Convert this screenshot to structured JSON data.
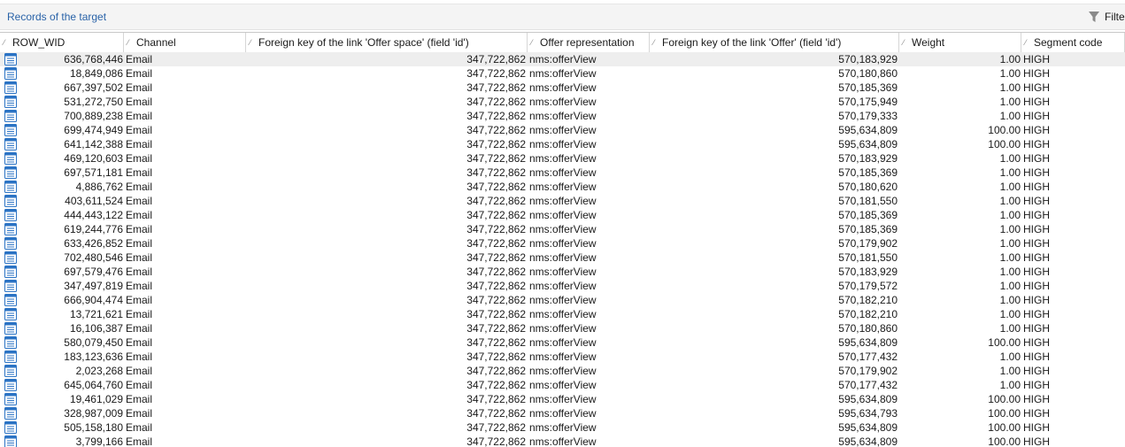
{
  "panel": {
    "title": "Records of the target"
  },
  "toolbar": {
    "filter_label": "Filte"
  },
  "table": {
    "columns": [
      "ROW_WID",
      "Channel",
      "Foreign key of the link 'Offer space' (field 'id')",
      "Offer representation",
      "Foreign key of the link 'Offer' (field 'id')",
      "Weight",
      "Segment code"
    ],
    "rows": [
      [
        "636,768,446",
        "Email",
        "347,722,862",
        "nms:offerView",
        "570,183,929",
        "1.00",
        "HIGH"
      ],
      [
        "18,849,086",
        "Email",
        "347,722,862",
        "nms:offerView",
        "570,180,860",
        "1.00",
        "HIGH"
      ],
      [
        "667,397,502",
        "Email",
        "347,722,862",
        "nms:offerView",
        "570,185,369",
        "1.00",
        "HIGH"
      ],
      [
        "531,272,750",
        "Email",
        "347,722,862",
        "nms:offerView",
        "570,175,949",
        "1.00",
        "HIGH"
      ],
      [
        "700,889,238",
        "Email",
        "347,722,862",
        "nms:offerView",
        "570,179,333",
        "1.00",
        "HIGH"
      ],
      [
        "699,474,949",
        "Email",
        "347,722,862",
        "nms:offerView",
        "595,634,809",
        "100.00",
        "HIGH"
      ],
      [
        "641,142,388",
        "Email",
        "347,722,862",
        "nms:offerView",
        "595,634,809",
        "100.00",
        "HIGH"
      ],
      [
        "469,120,603",
        "Email",
        "347,722,862",
        "nms:offerView",
        "570,183,929",
        "1.00",
        "HIGH"
      ],
      [
        "697,571,181",
        "Email",
        "347,722,862",
        "nms:offerView",
        "570,185,369",
        "1.00",
        "HIGH"
      ],
      [
        "4,886,762",
        "Email",
        "347,722,862",
        "nms:offerView",
        "570,180,620",
        "1.00",
        "HIGH"
      ],
      [
        "403,611,524",
        "Email",
        "347,722,862",
        "nms:offerView",
        "570,181,550",
        "1.00",
        "HIGH"
      ],
      [
        "444,443,122",
        "Email",
        "347,722,862",
        "nms:offerView",
        "570,185,369",
        "1.00",
        "HIGH"
      ],
      [
        "619,244,776",
        "Email",
        "347,722,862",
        "nms:offerView",
        "570,185,369",
        "1.00",
        "HIGH"
      ],
      [
        "633,426,852",
        "Email",
        "347,722,862",
        "nms:offerView",
        "570,179,902",
        "1.00",
        "HIGH"
      ],
      [
        "702,480,546",
        "Email",
        "347,722,862",
        "nms:offerView",
        "570,181,550",
        "1.00",
        "HIGH"
      ],
      [
        "697,579,476",
        "Email",
        "347,722,862",
        "nms:offerView",
        "570,183,929",
        "1.00",
        "HIGH"
      ],
      [
        "347,497,819",
        "Email",
        "347,722,862",
        "nms:offerView",
        "570,179,572",
        "1.00",
        "HIGH"
      ],
      [
        "666,904,474",
        "Email",
        "347,722,862",
        "nms:offerView",
        "570,182,210",
        "1.00",
        "HIGH"
      ],
      [
        "13,721,621",
        "Email",
        "347,722,862",
        "nms:offerView",
        "570,182,210",
        "1.00",
        "HIGH"
      ],
      [
        "16,106,387",
        "Email",
        "347,722,862",
        "nms:offerView",
        "570,180,860",
        "1.00",
        "HIGH"
      ],
      [
        "580,079,450",
        "Email",
        "347,722,862",
        "nms:offerView",
        "595,634,809",
        "100.00",
        "HIGH"
      ],
      [
        "183,123,636",
        "Email",
        "347,722,862",
        "nms:offerView",
        "570,177,432",
        "1.00",
        "HIGH"
      ],
      [
        "2,023,268",
        "Email",
        "347,722,862",
        "nms:offerView",
        "570,179,902",
        "1.00",
        "HIGH"
      ],
      [
        "645,064,760",
        "Email",
        "347,722,862",
        "nms:offerView",
        "570,177,432",
        "1.00",
        "HIGH"
      ],
      [
        "19,461,029",
        "Email",
        "347,722,862",
        "nms:offerView",
        "595,634,809",
        "100.00",
        "HIGH"
      ],
      [
        "328,987,009",
        "Email",
        "347,722,862",
        "nms:offerView",
        "595,634,793",
        "100.00",
        "HIGH"
      ],
      [
        "505,158,180",
        "Email",
        "347,722,862",
        "nms:offerView",
        "595,634,809",
        "100.00",
        "HIGH"
      ],
      [
        "3,799,166",
        "Email",
        "347,722,862",
        "nms:offerView",
        "595,634,809",
        "100.00",
        "HIGH"
      ]
    ]
  },
  "icons": {
    "filter": "filter-funnel-icon",
    "row": "record-icon",
    "sort": "sort-indicator-icon"
  },
  "colors": {
    "title": "#2a63a8",
    "row_icon": "#2b73c4",
    "selected_row": "#eeeeee"
  }
}
